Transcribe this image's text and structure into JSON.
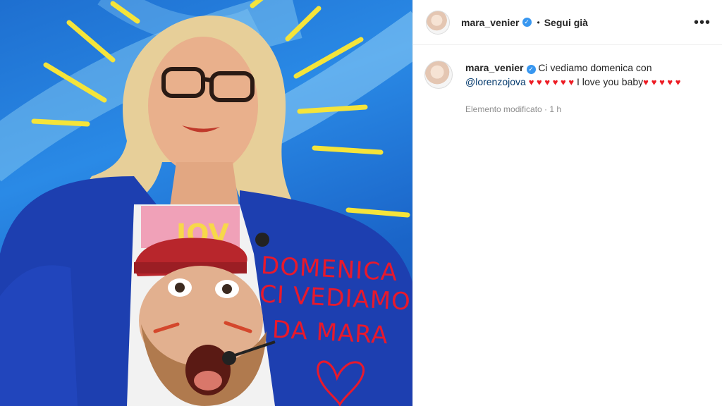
{
  "photo": {
    "overlay_lines": [
      "DOMENICA",
      "CI VEDIAMO",
      "DA MARA"
    ],
    "shirt_text": "JOV",
    "colors": {
      "background": "#1e6fd0",
      "sparkle": "#f5e43a",
      "handwriting": "#e8192c",
      "jacket": "#1d3fb0"
    }
  },
  "header": {
    "username": "mara_venier",
    "separator": "•",
    "follow_label": "Segui già",
    "more_icon": "more-horizontal-icon"
  },
  "caption": {
    "username": "mara_venier",
    "text_start": "Ci vediamo domenica con",
    "mention": "@lorenzojova",
    "hearts_a": "♥ ♥ ♥ ♥ ♥ ♥",
    "text_mid": "I love you baby",
    "hearts_b": "♥",
    "hearts_c": "♥ ♥ ♥ ♥",
    "meta": "Elemento modificato · 1 h"
  },
  "colors": {
    "accent": "#3897f0",
    "heart": "#ed1c24",
    "link": "#00376b"
  }
}
